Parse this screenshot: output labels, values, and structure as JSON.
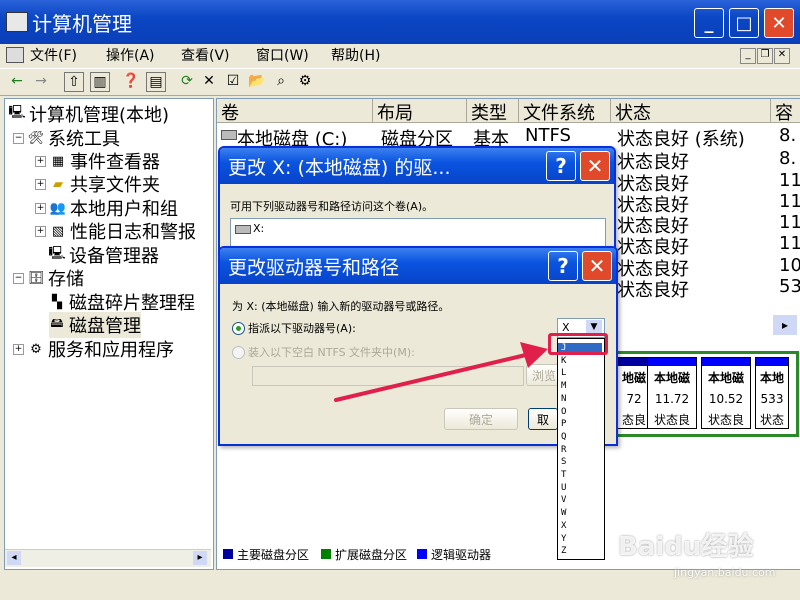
{
  "app": {
    "title": "计算机管理"
  },
  "menu": [
    "文件(F)",
    "操作(A)",
    "查看(V)",
    "窗口(W)",
    "帮助(H)"
  ],
  "tree": [
    {
      "label": "计算机管理(本地)",
      "indent": 0
    },
    {
      "label": "系统工具",
      "indent": 1
    },
    {
      "label": "事件查看器",
      "indent": 2
    },
    {
      "label": "共享文件夹",
      "indent": 2
    },
    {
      "label": "本地用户和组",
      "indent": 2
    },
    {
      "label": "性能日志和警报",
      "indent": 2
    },
    {
      "label": "设备管理器",
      "indent": 2
    },
    {
      "label": "存储",
      "indent": 1
    },
    {
      "label": "磁盘碎片整理程",
      "indent": 2
    },
    {
      "label": "磁盘管理",
      "indent": 2
    },
    {
      "label": "服务和应用程序",
      "indent": 1
    }
  ],
  "table": {
    "columns": [
      "卷",
      "布局",
      "类型",
      "文件系统",
      "状态",
      "容"
    ],
    "row1": {
      "volume": "本地磁盘 (C:)",
      "layout": "磁盘分区",
      "type": "基本",
      "fs": "NTFS",
      "status": "状态良好 (系统)",
      "cap": "8."
    },
    "statuses": [
      "状态良好",
      "状态良好",
      "状态良好",
      "状态良好",
      "状态良好",
      "状态良好",
      "状态良好"
    ],
    "caps": [
      "8.",
      "11",
      "11",
      "11",
      "11",
      "10",
      "53"
    ]
  },
  "disks": [
    {
      "label": "地磁",
      "size": "72",
      "status": "态良"
    },
    {
      "label": "本地磁",
      "size": "11.72",
      "status": "状态良"
    },
    {
      "label": "本地磁",
      "size": "10.52",
      "status": "状态良"
    },
    {
      "label": "本地",
      "size": "533",
      "status": "状态"
    }
  ],
  "legend": [
    "主要磁盘分区",
    "扩展磁盘分区",
    "逻辑驱动器"
  ],
  "colors": {
    "primary": "#0000a0",
    "extended": "#008000",
    "logical": "#0000ff"
  },
  "dialog_back": {
    "title": "更改 X: (本地磁盘) 的驱...",
    "instruction": "可用下列驱动器号和路径访问这个卷(A)。",
    "item": "X:"
  },
  "dialog_front": {
    "title": "更改驱动器号和路径",
    "instruction": "为 X: (本地磁盘) 输入新的驱动器号或路径。",
    "radio1": "指派以下驱动器号(A):",
    "radio2": "装入以下空白 NTFS 文件夹中(M):",
    "browse": "浏览",
    "ok": "确定",
    "cancel": "取",
    "selected_letter": "X"
  },
  "drive_letters": [
    "J",
    "K",
    "L",
    "M",
    "N",
    "O",
    "P",
    "Q",
    "R",
    "S",
    "T",
    "U",
    "V",
    "W",
    "X",
    "Y",
    "Z"
  ],
  "highlighted_letter": "J",
  "watermark": {
    "brand": "Baidu经验",
    "url": "jingyan.baidu.com"
  }
}
